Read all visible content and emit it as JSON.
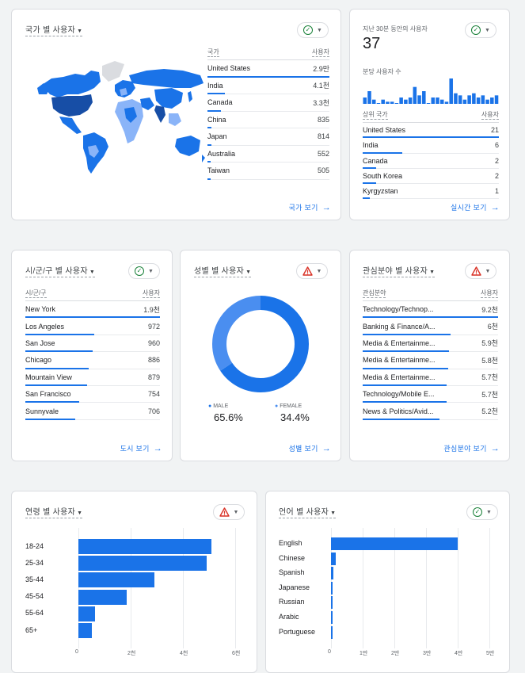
{
  "country": {
    "title": "국가 별 사용자",
    "col_country": "국가",
    "col_users": "사용자",
    "rows": [
      {
        "name": "United States",
        "value": "2.9만",
        "frac": 1.0
      },
      {
        "name": "India",
        "value": "4.1천",
        "frac": 0.14
      },
      {
        "name": "Canada",
        "value": "3.3천",
        "frac": 0.11
      },
      {
        "name": "China",
        "value": "835",
        "frac": 0.03
      },
      {
        "name": "Japan",
        "value": "814",
        "frac": 0.03
      },
      {
        "name": "Australia",
        "value": "552",
        "frac": 0.02
      },
      {
        "name": "Taiwan",
        "value": "505",
        "frac": 0.02
      }
    ],
    "link": "국가 보기"
  },
  "realtime": {
    "title": "지난 30분 동안의 사용자",
    "count": "37",
    "per_minute_label": "분당 사용자 수",
    "minute_values": [
      3,
      6,
      2,
      0,
      2,
      1,
      1,
      0,
      3,
      2,
      3,
      8,
      4,
      6,
      0,
      3,
      3,
      2,
      1,
      12,
      5,
      4,
      2,
      4,
      5,
      3,
      4,
      2,
      3,
      4
    ],
    "col_country": "상위 국가",
    "col_users": "사용자",
    "rows": [
      {
        "name": "United States",
        "value": "21",
        "frac": 1.0
      },
      {
        "name": "India",
        "value": "6",
        "frac": 0.29
      },
      {
        "name": "Canada",
        "value": "2",
        "frac": 0.1
      },
      {
        "name": "South Korea",
        "value": "2",
        "frac": 0.1
      },
      {
        "name": "Kyrgyzstan",
        "value": "1",
        "frac": 0.05
      }
    ],
    "link": "실시간 보기"
  },
  "city": {
    "title": "시/군/구 별 사용자",
    "col_city": "시/군/구",
    "col_users": "사용자",
    "rows": [
      {
        "name": "New York",
        "value": "1.9천",
        "frac": 1.0
      },
      {
        "name": "Los Angeles",
        "value": "972",
        "frac": 0.51
      },
      {
        "name": "San Jose",
        "value": "960",
        "frac": 0.5
      },
      {
        "name": "Chicago",
        "value": "886",
        "frac": 0.47
      },
      {
        "name": "Mountain View",
        "value": "879",
        "frac": 0.46
      },
      {
        "name": "San Francisco",
        "value": "754",
        "frac": 0.4
      },
      {
        "name": "Sunnyvale",
        "value": "706",
        "frac": 0.37
      }
    ],
    "link": "도시 보기"
  },
  "gender": {
    "title": "성별 별 사용자",
    "male_label": "MALE",
    "male_value": "65.6%",
    "male_frac": 0.656,
    "female_label": "FEMALE",
    "female_value": "34.4%",
    "female_frac": 0.344,
    "male_color": "#1a73e8",
    "female_color": "#4a8ef0",
    "link": "성별 보기"
  },
  "interest": {
    "title": "관심분야 별 사용자",
    "col_interest": "관심분야",
    "col_users": "사용자",
    "rows": [
      {
        "name": "Technology/Technop...",
        "value": "9.2천",
        "frac": 1.0
      },
      {
        "name": "Banking & Finance/A...",
        "value": "6천",
        "frac": 0.65
      },
      {
        "name": "Media & Entertainme...",
        "value": "5.9천",
        "frac": 0.64
      },
      {
        "name": "Media & Entertainme...",
        "value": "5.8천",
        "frac": 0.63
      },
      {
        "name": "Media & Entertainme...",
        "value": "5.7천",
        "frac": 0.62
      },
      {
        "name": "Technology/Mobile E...",
        "value": "5.7천",
        "frac": 0.62
      },
      {
        "name": "News & Politics/Avid...",
        "value": "5.2천",
        "frac": 0.57
      }
    ],
    "link": "관심분야 보기"
  },
  "age": {
    "title": "연령 별 사용자",
    "categories": [
      "18-24",
      "25-34",
      "35-44",
      "45-54",
      "55-64",
      "65+"
    ],
    "values": [
      5100,
      4900,
      2900,
      1850,
      650,
      520
    ],
    "ticks": [
      "0",
      "2천",
      "4천",
      "6천"
    ],
    "max": 6000
  },
  "language": {
    "title": "언어 별 사용자",
    "categories": [
      "English",
      "Chinese",
      "Spanish",
      "Japanese",
      "Russian",
      "Arabic",
      "Portuguese"
    ],
    "values": [
      40000,
      1600,
      700,
      500,
      400,
      300,
      250
    ],
    "ticks": [
      "0",
      "1만",
      "2만",
      "3만",
      "4만",
      "5만"
    ],
    "max": 50000
  },
  "colors": {
    "accent": "#1a73e8",
    "map_dark": "#174ea6",
    "map_mid": "#1a73e8",
    "map_light": "#8ab4f8",
    "map_none": "#dadce0",
    "ok": "#188038",
    "warn": "#d93025"
  }
}
